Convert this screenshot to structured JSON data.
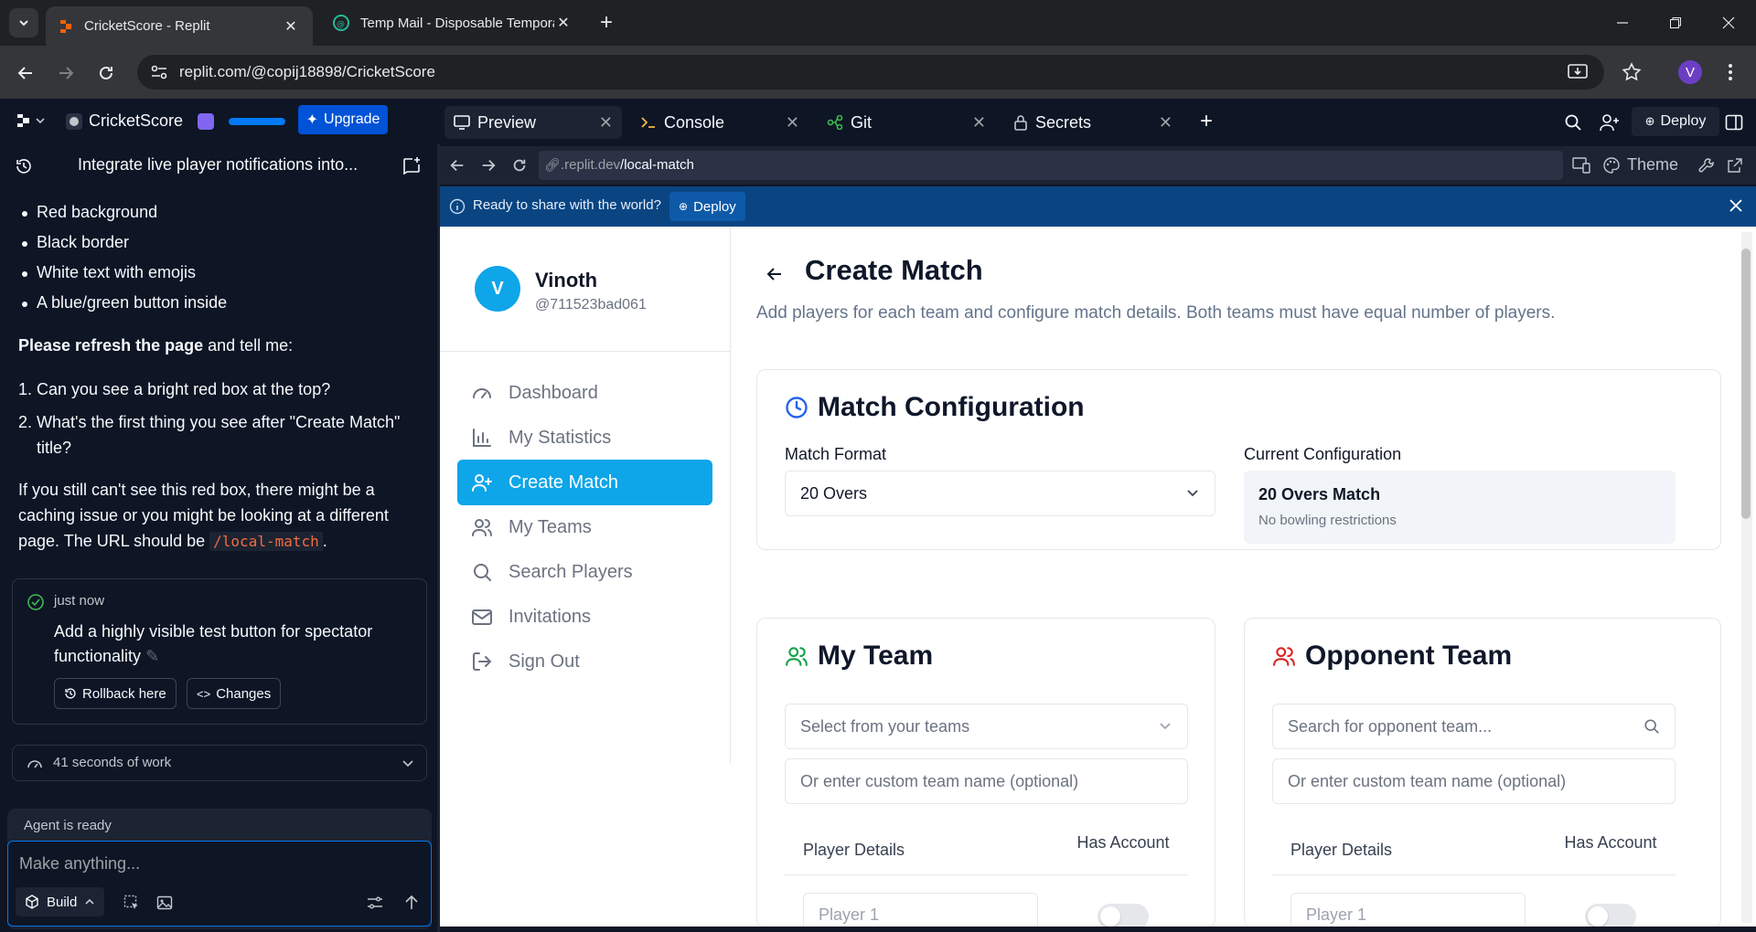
{
  "browser": {
    "tabs": [
      {
        "title": "CricketScore - Replit",
        "active": true
      },
      {
        "title": "Temp Mail - Disposable Tempora",
        "active": false
      }
    ],
    "url": "replit.com/@copij18898/CricketScore",
    "profile_initial": "V"
  },
  "replit": {
    "project_name": "CricketScore",
    "upgrade_label": "Upgrade",
    "tabs": [
      {
        "label": "Preview",
        "active": true
      },
      {
        "label": "Console",
        "active": false
      },
      {
        "label": "Git",
        "active": false
      },
      {
        "label": "Secrets",
        "active": false
      }
    ],
    "deploy_label": "Deploy"
  },
  "agent": {
    "thread_title": "Integrate live player notifications into...",
    "bullets": [
      "Red background",
      "Black border",
      "White text with emojis",
      "A blue/green button inside"
    ],
    "refresh_bold": "Please refresh the page",
    "refresh_rest": " and tell me:",
    "questions": [
      "Can you see a bright red box at the top?",
      "What's the first thing you see after \"Create Match\" title?"
    ],
    "note_line1": "If you still can't see this red box, there might be a",
    "note_line2": "caching issue or you might be looking at a different",
    "note_line3_pre": "page. The URL should be ",
    "note_code": "/local-match",
    "note_line3_post": ".",
    "checkpoint": {
      "time": "just now",
      "message": "Add a highly visible test button for spectator functionality",
      "rollback_label": "Rollback here",
      "changes_label": "Changes"
    },
    "work_summary": "41 seconds of work",
    "status": "Agent is ready",
    "input_placeholder": "Make anything...",
    "build_label": "Build"
  },
  "preview": {
    "url_prefix": ".replit.dev",
    "url_path": "/local-match",
    "theme_label": "Theme",
    "banner_text": "Ready to share with the world?",
    "banner_deploy": "Deploy"
  },
  "app": {
    "user": {
      "initial": "V",
      "name": "Vinoth",
      "handle": "@711523bad061"
    },
    "nav": [
      {
        "label": "Dashboard",
        "icon": "gauge-icon",
        "active": false
      },
      {
        "label": "My Statistics",
        "icon": "bar-chart-icon",
        "active": false
      },
      {
        "label": "Create Match",
        "icon": "user-plus-icon",
        "active": true
      },
      {
        "label": "My Teams",
        "icon": "users-icon",
        "active": false
      },
      {
        "label": "Search Players",
        "icon": "search-icon",
        "active": false
      },
      {
        "label": "Invitations",
        "icon": "mail-icon",
        "active": false
      },
      {
        "label": "Sign Out",
        "icon": "logout-icon",
        "active": false
      }
    ],
    "page_title": "Create Match",
    "page_subtitle": "Add players for each team and configure match details. Both teams must have equal number of players.",
    "config": {
      "title": "Match Configuration",
      "format_label": "Match Format",
      "format_value": "20 Overs",
      "current_label": "Current Configuration",
      "current_title": "20 Overs Match",
      "current_sub": "No bowling restrictions"
    },
    "my_team": {
      "title": "My Team",
      "select_placeholder": "Select from your teams",
      "custom_placeholder": "Or enter custom team name (optional)",
      "col_player": "Player Details",
      "col_account": "Has Account",
      "player1_placeholder": "Player 1"
    },
    "opponent_team": {
      "title": "Opponent Team",
      "search_placeholder": "Search for opponent team...",
      "custom_placeholder": "Or enter custom team name (optional)",
      "col_player": "Player Details",
      "col_account": "Has Account",
      "player1_placeholder": "Player 1"
    }
  },
  "colors": {
    "accent": "#0ea5e9",
    "replit_bg": "#0e1525",
    "banner": "#0a4582",
    "upgrade": "#0053d6"
  }
}
